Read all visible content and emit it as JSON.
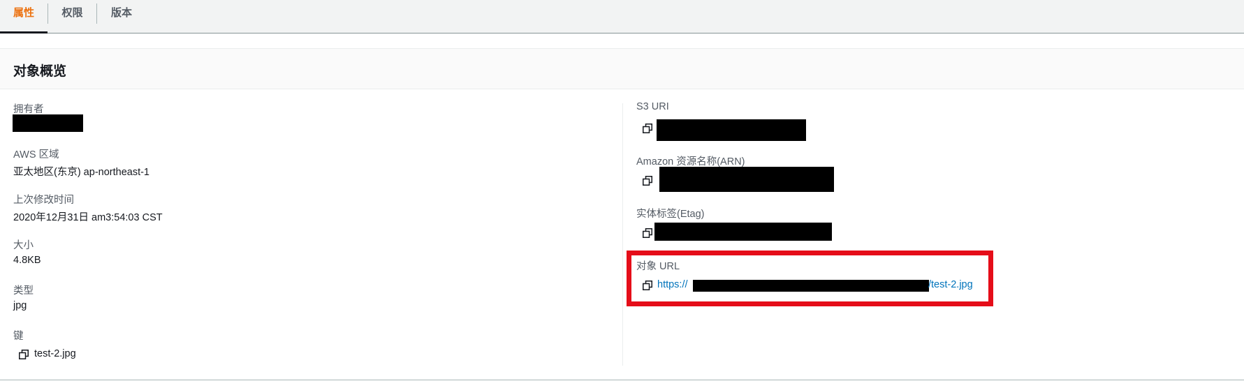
{
  "tabs": [
    {
      "label": "属性",
      "active": true
    },
    {
      "label": "权限",
      "active": false
    },
    {
      "label": "版本",
      "active": false
    }
  ],
  "panel": {
    "title": "对象概览"
  },
  "left": {
    "owner_label": "拥有者",
    "region_label": "AWS 区域",
    "region_value": "亚太地区(东京) ap-northeast-1",
    "modified_label": "上次修改时间",
    "modified_value": "2020年12月31日 am3:54:03 CST",
    "size_label": "大小",
    "size_value": "4.8KB",
    "type_label": "类型",
    "type_value": "jpg",
    "key_label": "键",
    "key_value": "test-2.jpg"
  },
  "right": {
    "s3uri_label": "S3 URI",
    "arn_label": "Amazon 资源名称(ARN)",
    "etag_label": "实体标签(Etag)",
    "url_label": "对象 URL",
    "url_prefix": "https://",
    "url_suffix": "/test-2.jpg"
  },
  "colors": {
    "active_tab": "#ec7211",
    "link": "#0073bb",
    "highlight": "#e50d19"
  },
  "icons": [
    "copy-icon"
  ]
}
